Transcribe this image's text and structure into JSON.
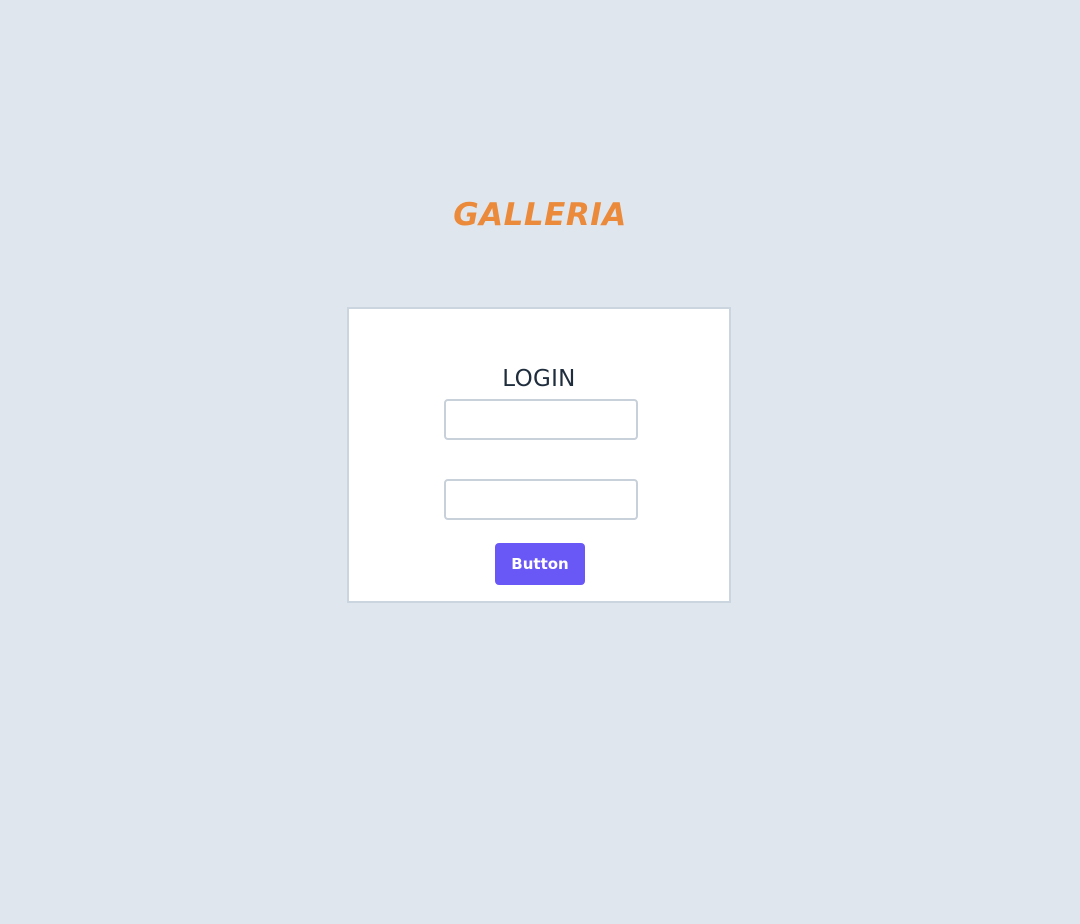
{
  "brand": {
    "name": "GALLERIA",
    "color": "#ea8a3a"
  },
  "login": {
    "title": "LOGIN",
    "username": {
      "value": "",
      "placeholder": ""
    },
    "password": {
      "value": "",
      "placeholder": ""
    },
    "submit_label": "Button",
    "submit_color": "#6a58f6"
  },
  "colors": {
    "background": "#e0e6ee",
    "card_background": "#ffffff",
    "card_border": "#cbd5df",
    "title_text": "#1f2d3d"
  }
}
